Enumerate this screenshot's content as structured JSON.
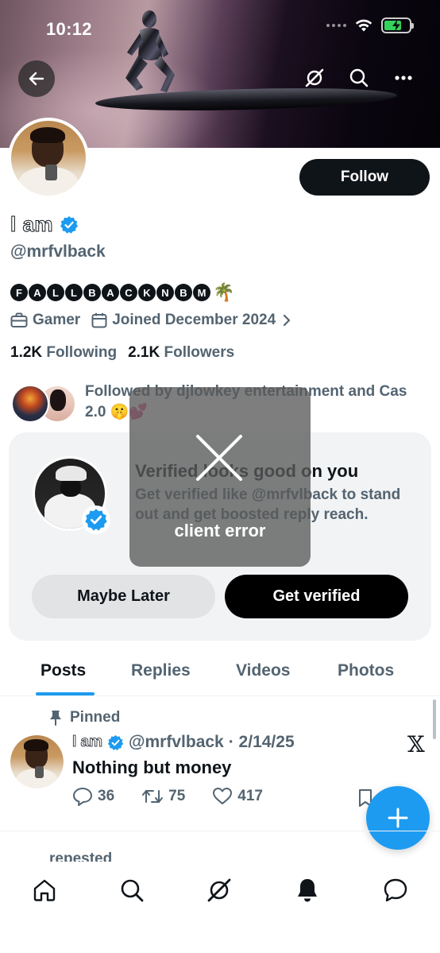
{
  "status_bar": {
    "time": "10:12"
  },
  "profile": {
    "display_name": "l am",
    "handle": "@mrfvlback",
    "bio_letters": [
      "F",
      "A",
      "L",
      "L",
      "B",
      "A",
      "C",
      "K",
      "N",
      "B",
      "M"
    ],
    "bio_emoji": "🌴",
    "category": "Gamer",
    "joined": "Joined December 2024",
    "following_count": "1.2K",
    "following_label": "Following",
    "followers_count": "2.1K",
    "followers_label": "Followers",
    "followed_by_text": "Followed by djlowkey entertainment and Cas 2.0 🤫💕",
    "follow_label": "Follow"
  },
  "verified_card": {
    "title": "Verified looks good on you",
    "description": "Get verified like @mrfvlback to stand out and get boosted reply reach.",
    "later_label": "Maybe Later",
    "verify_label": "Get verified"
  },
  "error_toast": {
    "message": "client error"
  },
  "tabs": [
    "Posts",
    "Replies",
    "Videos",
    "Photos"
  ],
  "active_tab": "Posts",
  "post": {
    "pinned_label": "Pinned",
    "author_name": "l am",
    "author_handle": "@mrfvlback",
    "date": "· 2/14/25",
    "text": "Nothing but money",
    "replies": "36",
    "reposts": "75",
    "likes": "417"
  },
  "next_item_label": "repested",
  "colors": {
    "accent": "#1d9bf0",
    "text": "#0f1419",
    "muted": "#536471"
  }
}
